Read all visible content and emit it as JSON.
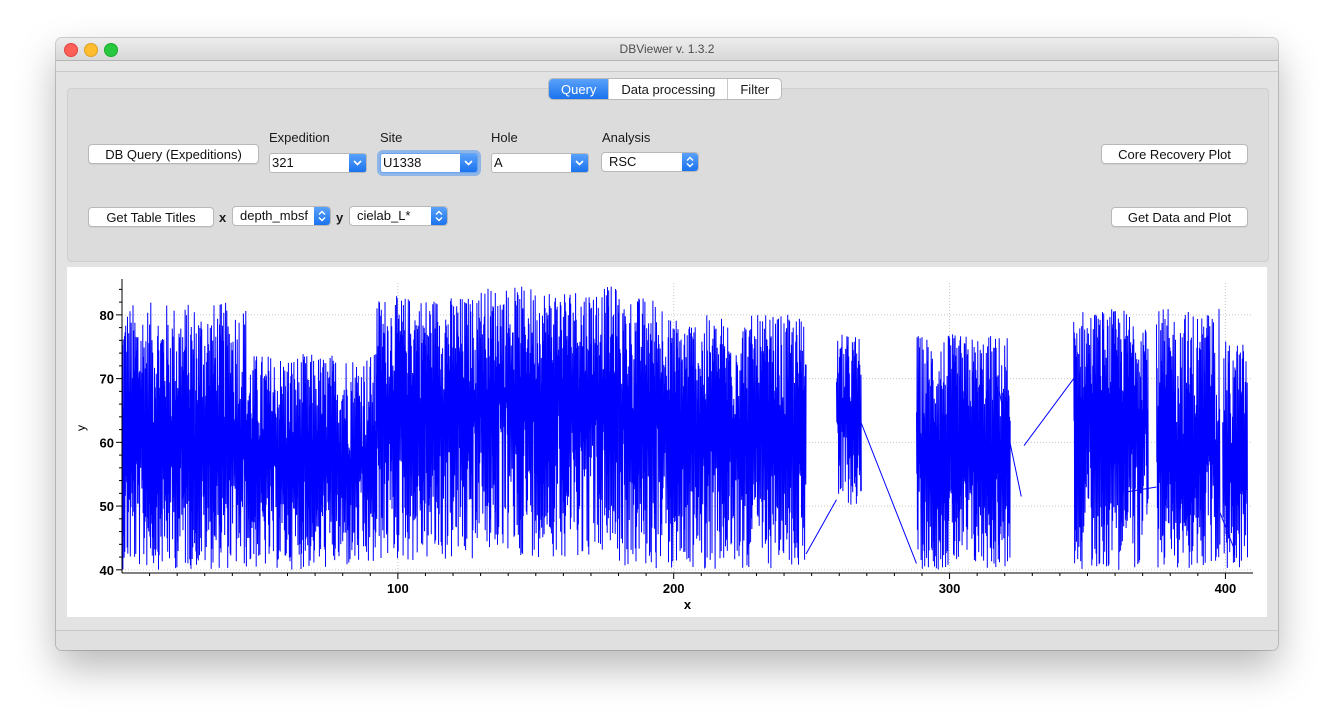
{
  "window": {
    "title": "DBViewer v. 1.3.2"
  },
  "tabs": [
    "Query",
    "Data processing",
    "Filter"
  ],
  "query": {
    "db_query_button": "DB Query (Expeditions)",
    "expedition": {
      "label": "Expedition",
      "value": "321"
    },
    "site": {
      "label": "Site",
      "value": "U1338"
    },
    "hole": {
      "label": "Hole",
      "value": "A"
    },
    "analysis": {
      "label": "Analysis",
      "value": "RSC"
    },
    "core_recovery_button": "Core Recovery Plot",
    "table_titles_button": "Get Table Titles",
    "x_label": "x",
    "x_value": "depth_mbsf",
    "y_label": "y",
    "y_value": "cielab_L*",
    "get_data_button": "Get Data and Plot"
  },
  "chart_data": {
    "type": "line",
    "title": "",
    "xlabel": "x",
    "ylabel": "y",
    "xlim": [
      0,
      410
    ],
    "ylim": [
      39.5,
      85
    ],
    "xticks": [
      100,
      200,
      300,
      400
    ],
    "yticks": [
      40,
      50,
      60,
      70,
      80
    ],
    "grid": true,
    "line_color": "#0000ff",
    "series": [
      {
        "segments": [
          {
            "x_range": [
              0,
              45
            ],
            "y_min": 40,
            "y_max": 82,
            "center": 60
          },
          {
            "x_range": [
              45,
              92
            ],
            "y_min": 40,
            "y_max": 74,
            "center": 57
          },
          {
            "x_range": [
              92,
              130
            ],
            "y_min": 41,
            "y_max": 83,
            "center": 66
          },
          {
            "x_range": [
              130,
              180
            ],
            "y_min": 42,
            "y_max": 84.5,
            "center": 68
          },
          {
            "x_range": [
              180,
              196
            ],
            "y_min": 40,
            "y_max": 83,
            "center": 64
          },
          {
            "x_range": [
              196,
              248
            ],
            "y_min": 40,
            "y_max": 80,
            "center": 61
          },
          {
            "x_range": [
              259,
              268
            ],
            "y_min": 50,
            "y_max": 77,
            "center": 64
          },
          {
            "x_range": [
              288,
              322
            ],
            "y_min": 40,
            "y_max": 77,
            "center": 58
          },
          {
            "x_range": [
              345,
              372
            ],
            "y_min": 40,
            "y_max": 81,
            "center": 65
          },
          {
            "x_range": [
              375,
              398
            ],
            "y_min": 40,
            "y_max": 81,
            "center": 58
          },
          {
            "x_range": [
              399,
              408
            ],
            "y_min": 40,
            "y_max": 76,
            "center": 56
          }
        ],
        "connectors": [
          [
            [
              248,
              42.5
            ],
            [
              259,
              51
            ]
          ],
          [
            [
              268,
              63
            ],
            [
              288,
              41
            ]
          ],
          [
            [
              318,
              68
            ],
            [
              326,
              51.5
            ]
          ],
          [
            [
              327,
              59.5
            ],
            [
              345,
              70
            ]
          ],
          [
            [
              364,
              52.2
            ],
            [
              375,
              53
            ]
          ],
          [
            [
              398,
              49
            ],
            [
              403,
              43.5
            ]
          ]
        ]
      }
    ]
  }
}
